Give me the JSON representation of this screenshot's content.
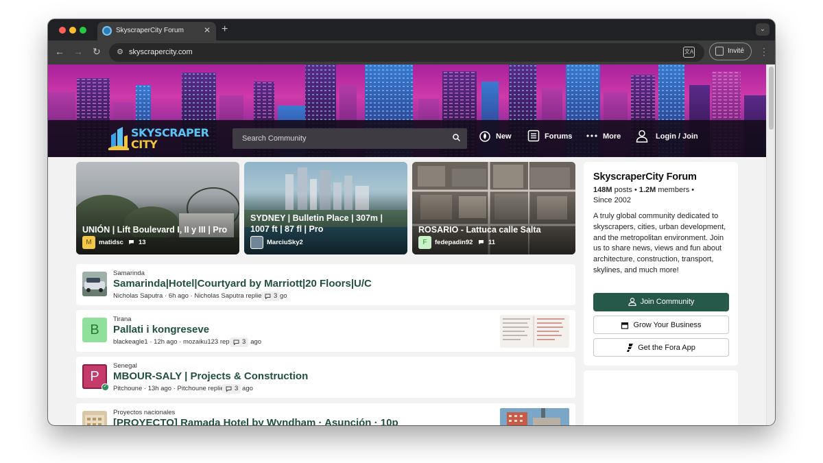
{
  "browser": {
    "tab_title": "SkyscraperCity Forum",
    "tab_close": "✕",
    "new_tab": "+",
    "url": "skyscrapercity.com",
    "profile_label": "Invité"
  },
  "site": {
    "logo_line1": "SKYSCRAPER",
    "logo_line2": "CITY",
    "search_placeholder": "Search Community",
    "nav": {
      "new": "New",
      "forums": "Forums",
      "more": "More",
      "login": "Login / Join"
    }
  },
  "featured": [
    {
      "title": "UNIÓN | Lift Boulevard I, II y III | Pro",
      "avatar_letter": "M",
      "user": "matidsc",
      "comments": "13"
    },
    {
      "title": "SYDNEY | Bulletin Place | 307m | 1007 ft | 87 fl | Pro",
      "avatar_letter": "",
      "user": "MarciuSky2",
      "comments": ""
    },
    {
      "title": "ROSARIO - Lattuca calle Salta",
      "avatar_letter": "F",
      "user": "fedepadin92",
      "comments": "11"
    }
  ],
  "threads": [
    {
      "forum": "Samarinda",
      "title": "Samarinda|Hotel|Courtyard by Marriott|20 Floors|U/C",
      "author": "Nicholas Saputra",
      "age": "6h ago",
      "last": "Nicholas Saputra replied 6h ago",
      "replies": "3",
      "letter": ""
    },
    {
      "forum": "Tirana",
      "title": "Pallati i kongreseve",
      "author": "blackeagle1",
      "age": "12h ago",
      "last": "mozaiku123 replied 2h ago",
      "replies": "3",
      "letter": "B"
    },
    {
      "forum": "Senegal",
      "title": "MBOUR-SALY | Projects & Construction",
      "author": "Pitchoune",
      "age": "13h ago",
      "last": "Pitchoune replied 12h ago",
      "replies": "3",
      "letter": "P"
    },
    {
      "forum": "Proyectos nacionales",
      "title": "[PROYECTO] Ramada Hotel by Wyndham · Asunción · 10p",
      "author": "",
      "age": "",
      "last": "",
      "replies": "",
      "letter": ""
    }
  ],
  "sidebar": {
    "title": "SkyscraperCity Forum",
    "posts": "148M",
    "posts_label": "posts",
    "members": "1.2M",
    "members_label": "members",
    "since": "Since 2002",
    "description": "A truly global community dedicated to skyscrapers, cities, urban development, and the metropolitan environment. Join us to share news, views and fun about architecture, construction, transport, skylines, and much more!",
    "join": "Join Community",
    "business": "Grow Your Business",
    "app": "Get the Fora App"
  },
  "colors": {
    "brand_green": "#26594a",
    "title_green": "#215040",
    "hero_magenta": "#cf3aa9"
  }
}
